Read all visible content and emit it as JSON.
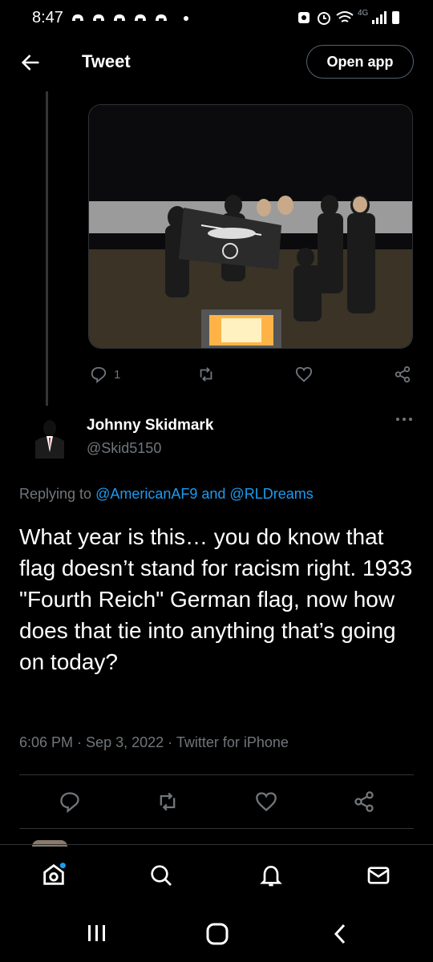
{
  "status_bar": {
    "time": "8:47",
    "network": "4G"
  },
  "header": {
    "title": "Tweet",
    "open_app": "Open app"
  },
  "parent_tweet": {
    "reply_count": "1"
  },
  "tweet": {
    "name": "Johnny Skidmark",
    "handle": "@Skid5150",
    "replying_prefix": "Replying to ",
    "mention1": "@AmericanAF9",
    "and": " and ",
    "mention2": "@RLDreams",
    "text": "What year is this… you do know that flag doesn’t stand for racism right. 1933 \"Fourth Reich\" German flag, now how does that tie into anything that’s going on today?",
    "time": "6:06 PM",
    "sep": " · ",
    "date": "Sep 3, 2022",
    "source": "Twitter for iPhone"
  },
  "colors": {
    "accent": "#1d9bf0",
    "muted": "#71767b",
    "divider": "#2f3336"
  }
}
